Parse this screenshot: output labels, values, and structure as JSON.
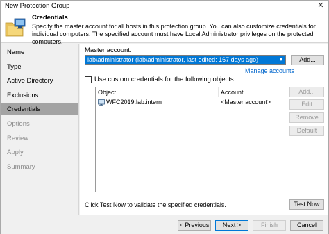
{
  "window": {
    "title": "New Protection Group",
    "close_glyph": "✕"
  },
  "header": {
    "title": "Credentials",
    "description": "Specify the master account for all hosts in this protection group. You can also customize credentials for individual computers. The specified account must have Local Administrator privileges on the protected computers."
  },
  "sidebar": {
    "items": [
      {
        "label": "Name",
        "state": "normal"
      },
      {
        "label": "Type",
        "state": "normal"
      },
      {
        "label": "Active Directory",
        "state": "normal"
      },
      {
        "label": "Exclusions",
        "state": "normal"
      },
      {
        "label": "Credentials",
        "state": "active"
      },
      {
        "label": "Options",
        "state": "disabled"
      },
      {
        "label": "Review",
        "state": "disabled"
      },
      {
        "label": "Apply",
        "state": "disabled"
      },
      {
        "label": "Summary",
        "state": "disabled"
      }
    ]
  },
  "content": {
    "master_account_label": "Master account:",
    "master_account_value": "lab\\administrator (lab\\administrator, last edited: 167 days ago)",
    "add_button": "Add...",
    "manage_accounts_link": "Manage accounts",
    "custom_credentials_label": "Use custom credentials for the following objects:",
    "custom_credentials_checked": false,
    "table": {
      "columns": [
        "Object",
        "Account"
      ],
      "rows": [
        {
          "object": "WFC2019.lab.intern",
          "account": "<Master account>"
        }
      ]
    },
    "side_buttons": {
      "add": "Add...",
      "edit": "Edit",
      "remove": "Remove",
      "default": "Default"
    },
    "hint": "Click Test Now to validate the specified credentials.",
    "test_now_button": "Test Now"
  },
  "footer": {
    "previous": "< Previous",
    "next": "Next >",
    "finish": "Finish",
    "cancel": "Cancel"
  },
  "colors": {
    "accent": "#0078d7",
    "link": "#0066cc",
    "active_nav": "#a3a3a3"
  },
  "icons": {
    "header": "folder-with-computers-icon",
    "row": "computer-icon"
  }
}
